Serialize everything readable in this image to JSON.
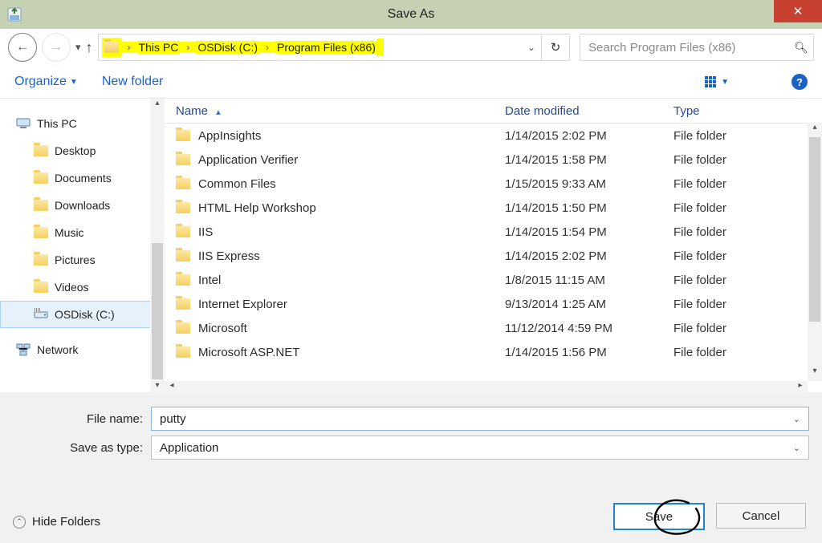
{
  "window": {
    "title": "Save As"
  },
  "breadcrumb": {
    "items": [
      "This PC",
      "OSDisk (C:)",
      "Program Files (x86)"
    ]
  },
  "search": {
    "placeholder": "Search Program Files (x86)"
  },
  "toolbar": {
    "organize": "Organize",
    "newfolder": "New folder"
  },
  "tree": {
    "root": "This PC",
    "items": [
      "Desktop",
      "Documents",
      "Downloads",
      "Music",
      "Pictures",
      "Videos",
      "OSDisk (C:)"
    ],
    "network": "Network"
  },
  "columns": {
    "name": "Name",
    "date": "Date modified",
    "type": "Type"
  },
  "rows": [
    {
      "name": "AppInsights",
      "date": "1/14/2015 2:02 PM",
      "type": "File folder"
    },
    {
      "name": "Application Verifier",
      "date": "1/14/2015 1:58 PM",
      "type": "File folder"
    },
    {
      "name": "Common Files",
      "date": "1/15/2015 9:33 AM",
      "type": "File folder"
    },
    {
      "name": "HTML Help Workshop",
      "date": "1/14/2015 1:50 PM",
      "type": "File folder"
    },
    {
      "name": "IIS",
      "date": "1/14/2015 1:54 PM",
      "type": "File folder"
    },
    {
      "name": "IIS Express",
      "date": "1/14/2015 2:02 PM",
      "type": "File folder"
    },
    {
      "name": "Intel",
      "date": "1/8/2015 11:15 AM",
      "type": "File folder"
    },
    {
      "name": "Internet Explorer",
      "date": "9/13/2014 1:25 AM",
      "type": "File folder"
    },
    {
      "name": "Microsoft",
      "date": "11/12/2014 4:59 PM",
      "type": "File folder"
    },
    {
      "name": "Microsoft ASP.NET",
      "date": "1/14/2015 1:56 PM",
      "type": "File folder"
    }
  ],
  "fields": {
    "filename_label": "File name:",
    "filename_value": "putty",
    "type_label": "Save as type:",
    "type_value": "Application"
  },
  "buttons": {
    "save": "Save",
    "cancel": "Cancel",
    "hide": "Hide Folders"
  }
}
